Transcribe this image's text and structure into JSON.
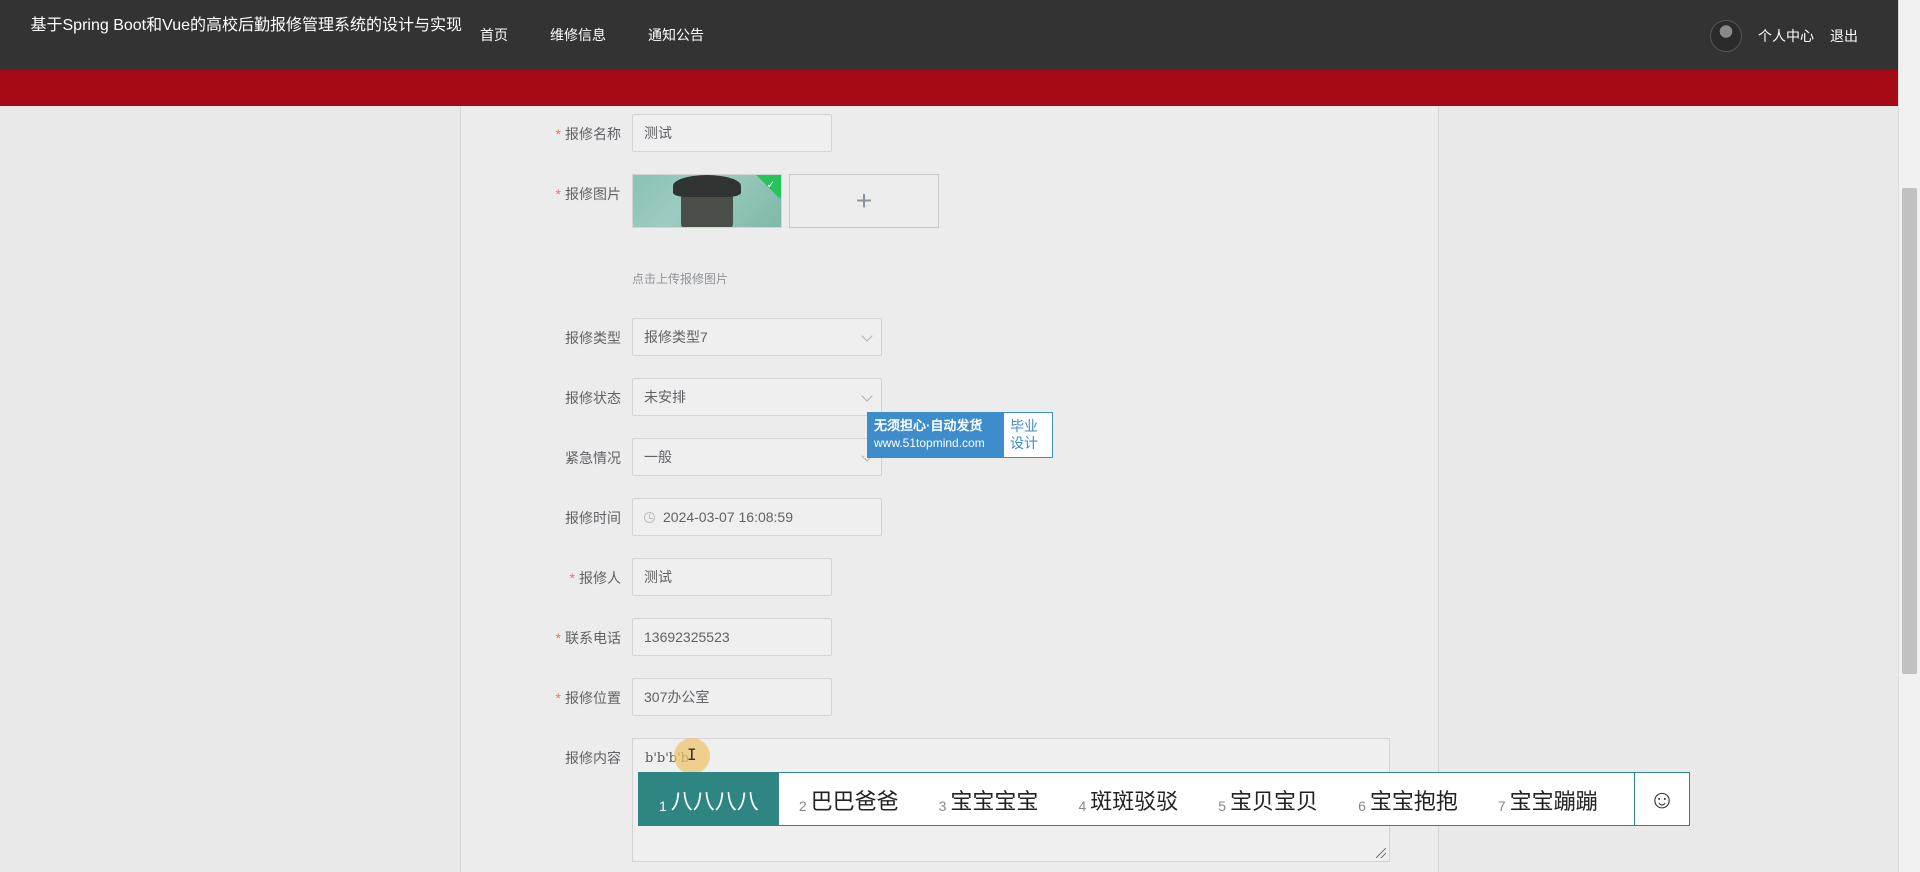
{
  "header": {
    "site_title": "基于Spring Boot和Vue的高校后勤报修管理系统的设计与实现",
    "nav": [
      "首页",
      "维修信息",
      "通知公告"
    ],
    "user_center": "个人中心",
    "logout": "退出"
  },
  "form": {
    "name": {
      "label": "报修名称",
      "value": "测试"
    },
    "image": {
      "label": "报修图片",
      "add_symbol": "+",
      "hint": "点击上传报修图片",
      "check_mark": "✓"
    },
    "type": {
      "label": "报修类型",
      "value": "报修类型7"
    },
    "status": {
      "label": "报修状态",
      "value": "未安排"
    },
    "urgency": {
      "label": "紧急情况",
      "value": "一般"
    },
    "time": {
      "label": "报修时间",
      "value": "2024-03-07 16:08:59"
    },
    "person": {
      "label": "报修人",
      "value": "测试"
    },
    "phone": {
      "label": "联系电话",
      "value": "13692325523"
    },
    "location": {
      "label": "报修位置",
      "value": "307办公室"
    },
    "content": {
      "label": "报修内容",
      "value": "b'b'b'b"
    },
    "required_mark": "*"
  },
  "watermark": {
    "line1": "无须担心·自动发货",
    "line2": "www.51topmind.com",
    "right": "毕业设计"
  },
  "ime": {
    "candidates": [
      {
        "num": "1",
        "text": "八八八八"
      },
      {
        "num": "2",
        "text": "巴巴爸爸"
      },
      {
        "num": "3",
        "text": "宝宝宝宝"
      },
      {
        "num": "4",
        "text": "斑斑驳驳"
      },
      {
        "num": "5",
        "text": "宝贝宝贝"
      },
      {
        "num": "6",
        "text": "宝宝抱抱"
      },
      {
        "num": "7",
        "text": "宝宝蹦蹦"
      }
    ],
    "emoji_symbol": "☺"
  },
  "colors": {
    "topbar": "#333333",
    "accent_band": "#a50a16",
    "required": "#f56c6c",
    "ime_accent": "#2f8582",
    "watermark_blue": "#3d8ccc"
  }
}
